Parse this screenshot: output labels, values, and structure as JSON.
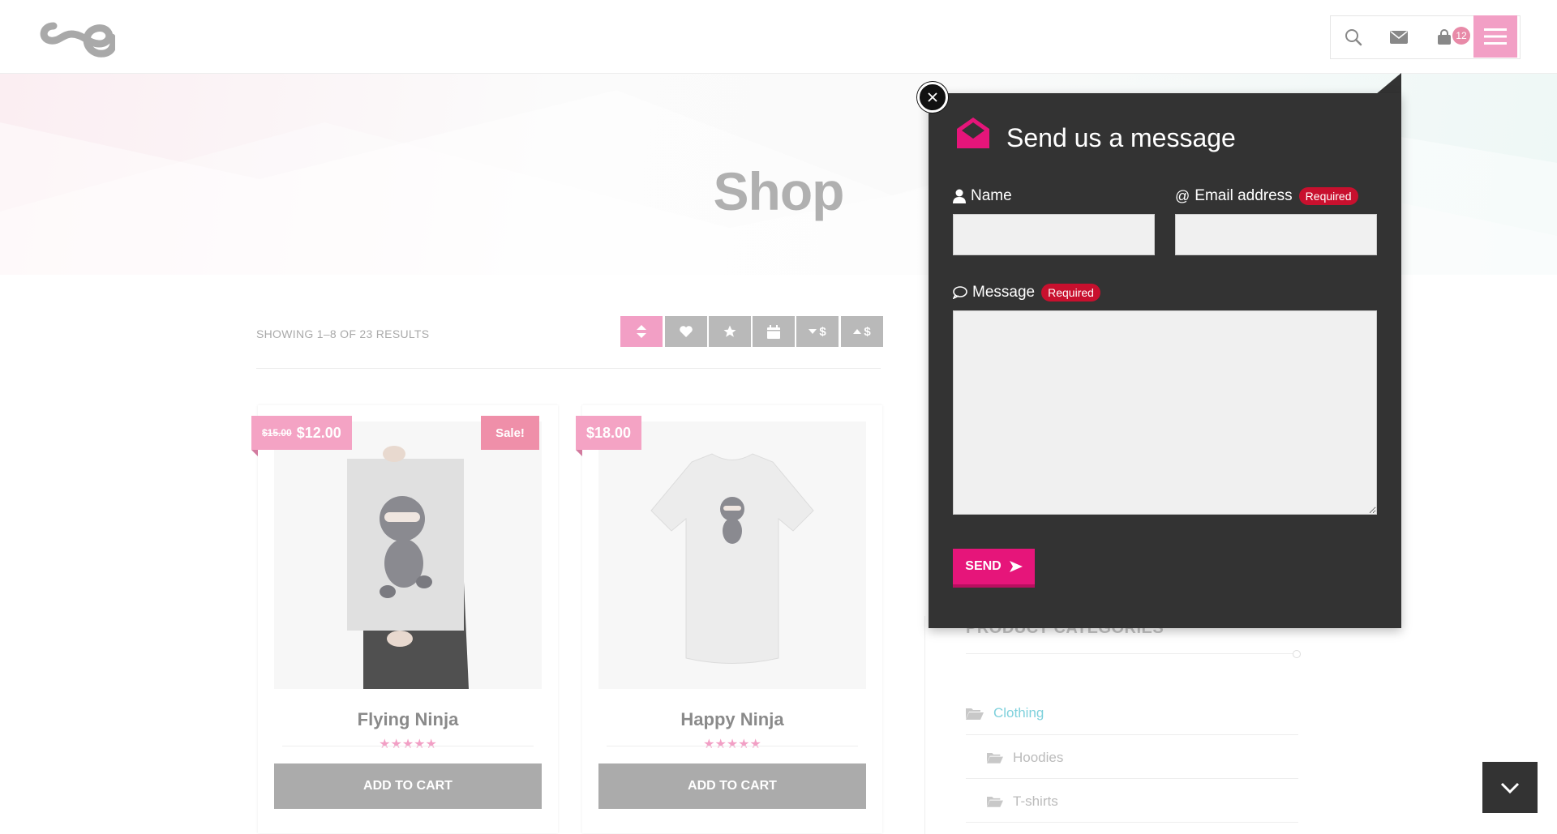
{
  "header": {
    "toolbar": {
      "search_icon": "search-icon",
      "mail_icon": "mail-icon",
      "cart_icon": "cart-icon",
      "cart_count": "12",
      "menu_icon": "hamburger-icon"
    }
  },
  "hero": {
    "title": "Shop"
  },
  "shop": {
    "results_text": "SHOWING 1–8 OF 23 RESULTS",
    "sort_buttons": [
      {
        "icon": "sort-icon",
        "label": "",
        "active": true
      },
      {
        "icon": "heart-icon",
        "label": ""
      },
      {
        "icon": "star-icon",
        "label": ""
      },
      {
        "icon": "calendar-icon",
        "label": ""
      },
      {
        "icon": "price-desc-icon",
        "label": "$"
      },
      {
        "icon": "price-asc-icon",
        "label": "$"
      }
    ],
    "products": [
      {
        "name": "Flying Ninja",
        "old_price": "$15.00",
        "price": "$12.00",
        "sale": "Sale!",
        "rating": 5,
        "button": "ADD TO CART"
      },
      {
        "name": "Happy Ninja",
        "price": "$18.00",
        "rating": 5,
        "button": "ADD TO CART"
      }
    ]
  },
  "sidebar": {
    "heading": "PRODUCT CATEGORIES",
    "categories": [
      {
        "label": "Clothing",
        "level": 0,
        "active": true
      },
      {
        "label": "Hoodies",
        "level": 1
      },
      {
        "label": "T-shirts",
        "level": 1
      }
    ]
  },
  "popup": {
    "title": "Send us a message",
    "name_label": "Name",
    "email_label": "Email address",
    "email_required": "Required",
    "message_label": "Message",
    "message_required": "Required",
    "name_value": "",
    "email_value": "",
    "message_value": "",
    "send_label": "SEND"
  },
  "colors": {
    "accent_pink": "#f29fc5",
    "send_magenta": "#e6157a",
    "popup_bg": "#333333",
    "required_red": "#c8102e",
    "category_active": "#7fd1dc"
  }
}
